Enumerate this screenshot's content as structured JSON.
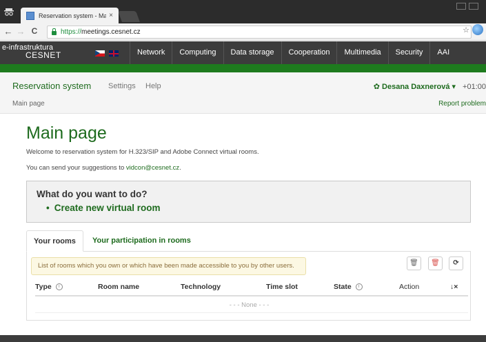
{
  "browser": {
    "tab_title": "Reservation system - Ma",
    "tab_close": "×",
    "url_scheme": "https://",
    "url_host": "meetings.cesnet.cz",
    "back_icon": "←",
    "forward_icon": "→",
    "reload_icon": "C",
    "star_icon": "☆"
  },
  "site_nav": {
    "brand_line1": "e-infrastruktura",
    "brand_line2": "CESNET",
    "items": [
      "Network",
      "Computing",
      "Data storage",
      "Cooperation",
      "Multimedia",
      "Security",
      "AAI"
    ]
  },
  "app_header": {
    "app_name": "Reservation system",
    "links": [
      "Settings",
      "Help"
    ],
    "user": "✿ Desana Daxnerová ▾",
    "timezone": "+01:00",
    "breadcrumb": "Main page",
    "report": "Report problem"
  },
  "main": {
    "heading": "Main page",
    "welcome": "Welcome to reservation system for H.323/SIP and Adobe Connect virtual rooms.",
    "suggest_prefix": "You can send your suggestions to ",
    "suggest_email": "vidcon@cesnet.cz",
    "suggest_suffix": ".",
    "what_question": "What do you want to do?",
    "what_item": "Create new virtual room"
  },
  "rooms": {
    "tabs": [
      "Your rooms",
      "Your participation in rooms"
    ],
    "hint": "List of rooms which you own or which have been made accessible to you by other users.",
    "columns": [
      "Type",
      "Room name",
      "Technology",
      "Time slot",
      "State",
      "Action"
    ],
    "info_icon": "i",
    "sort_icon": "↓×",
    "empty": "- - - None - - -",
    "btn_icons": [
      "🗑",
      "🗑",
      "⟳"
    ]
  },
  "colors": {
    "brand_green": "#1e6b1e",
    "nav_bg": "#3c3c3c",
    "green_bar": "#1e7b1e"
  }
}
